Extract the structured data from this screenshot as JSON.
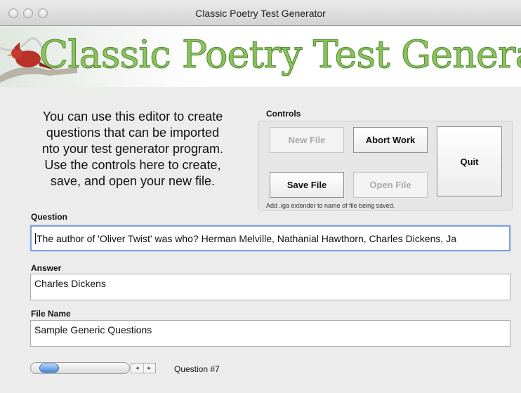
{
  "window": {
    "title": "Classic Poetry Test Generator"
  },
  "banner": {
    "title": "Classic Poetry Test Generator"
  },
  "intro": {
    "lines": [
      "You can use this editor to create",
      "questions that can be imported",
      "nto your test generator program.",
      "Use the controls here to create,",
      "save, and open your new file."
    ]
  },
  "controls": {
    "label": "Controls",
    "new_file": "New File",
    "abort_work": "Abort Work",
    "quit": "Quit",
    "save_file": "Save File",
    "open_file": "Open File",
    "note": "Add .iga extender to name of file being saved."
  },
  "question": {
    "label": "Question",
    "value": "The author of 'Oliver Twist' was who? Herman Melville, Nathanial Hawthorn, Charles Dickens, Ja"
  },
  "answer": {
    "label": "Answer",
    "value": "Charles Dickens"
  },
  "file_name": {
    "label": "File Name",
    "value": "Sample Generic Questions"
  },
  "navigation": {
    "stepper_back": "◂",
    "stepper_forward": "▸",
    "question_number": "Question #7"
  },
  "icons": {
    "close": "close-icon",
    "minimize": "minimize-icon",
    "zoom": "zoom-icon",
    "banner_art": "cardinal-bird-icon"
  },
  "colors": {
    "banner_title": "#8cc25c",
    "banner_outline": "#4f8a2f",
    "focus_ring": "#7ba2d8",
    "slider_thumb": "#4a87d9"
  }
}
